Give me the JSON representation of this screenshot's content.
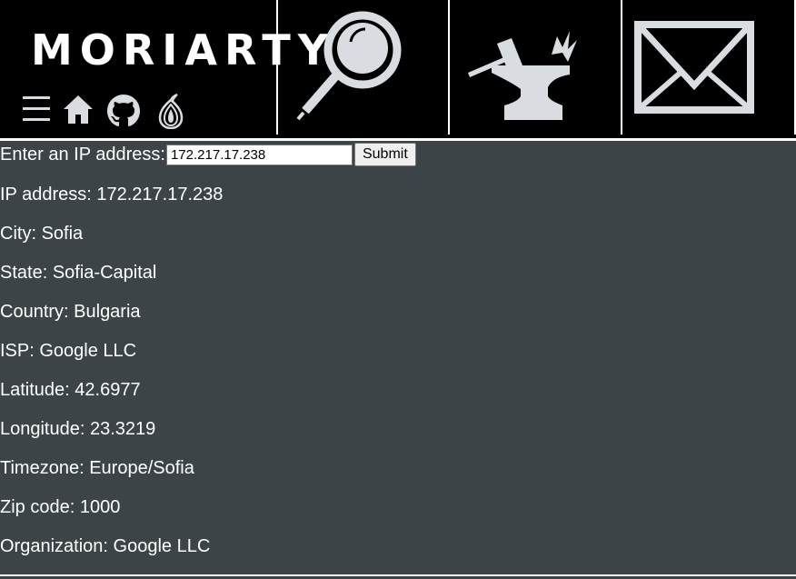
{
  "header": {
    "logo_text": "MORIARTY",
    "nav_icons": [
      "menu-icon",
      "home-icon",
      "github-icon",
      "tor-onion-icon"
    ],
    "tools": [
      "magnifying-glass-icon",
      "anvil-hammer-icon",
      "envelope-icon"
    ]
  },
  "form": {
    "label": "Enter an IP address:",
    "input_value": "172.217.17.238",
    "submit_label": "Submit"
  },
  "results": [
    {
      "label": "IP address",
      "value": "172.217.17.238"
    },
    {
      "label": "City",
      "value": "Sofia"
    },
    {
      "label": "State",
      "value": "Sofia-Capital"
    },
    {
      "label": "Country",
      "value": "Bulgaria"
    },
    {
      "label": "ISP",
      "value": "Google LLC"
    },
    {
      "label": "Latitude",
      "value": "42.6977"
    },
    {
      "label": "Longitude",
      "value": "23.3219"
    },
    {
      "label": "Timezone",
      "value": "Europe/Sofia"
    },
    {
      "label": "Zip code",
      "value": "1000"
    },
    {
      "label": "Organization",
      "value": "Google LLC"
    }
  ],
  "colors": {
    "header_bg": "#000000",
    "main_bg": "#3d4447",
    "icon_fill": "#d9dce0",
    "text": "#ffffff"
  }
}
